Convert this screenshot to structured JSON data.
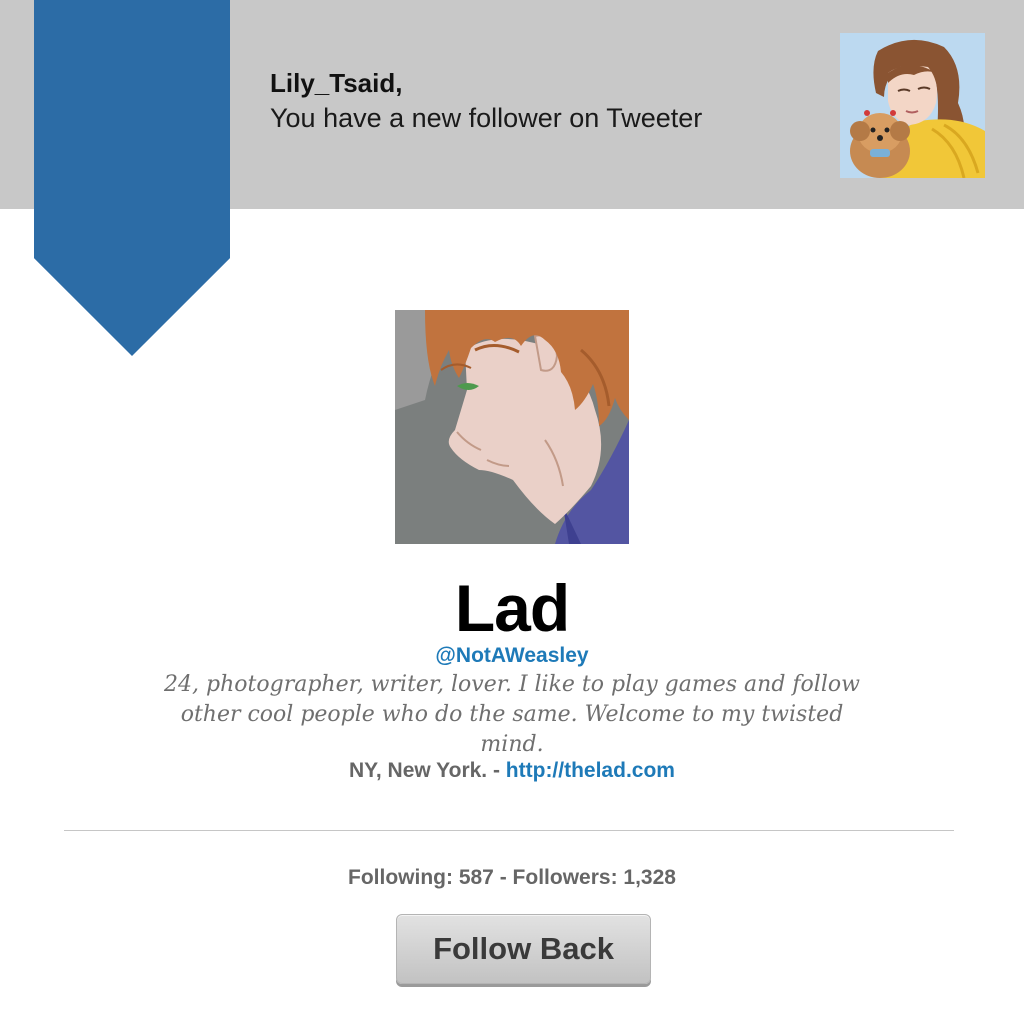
{
  "notification": {
    "user": "Lily_Tsaid,",
    "message": "You have a new follower on Tweeter"
  },
  "icons": {
    "ribbon": "bookmark-ribbon",
    "recipient_avatar": "avatar-woman-with-dog",
    "follower_avatar": "avatar-red-haired-man"
  },
  "profile": {
    "name": "Lad",
    "handle": "@NotAWeasley",
    "bio": "24, photographer, writer, lover. I like to play games and follow other cool people who do the same. Welcome to my twisted mind.",
    "location": "NY, New York. - ",
    "url": "http://thelad.com"
  },
  "stats": {
    "following_label": "Following: ",
    "following": "587",
    "separator": " - ",
    "followers_label": "Followers: ",
    "followers": "1,328"
  },
  "follow_button": {
    "label": "Follow Back"
  },
  "colors": {
    "ribbon": "#2c6ca6",
    "header_band": "#c8c8c8",
    "link": "#1e7ab8",
    "muted_text": "#666666"
  }
}
